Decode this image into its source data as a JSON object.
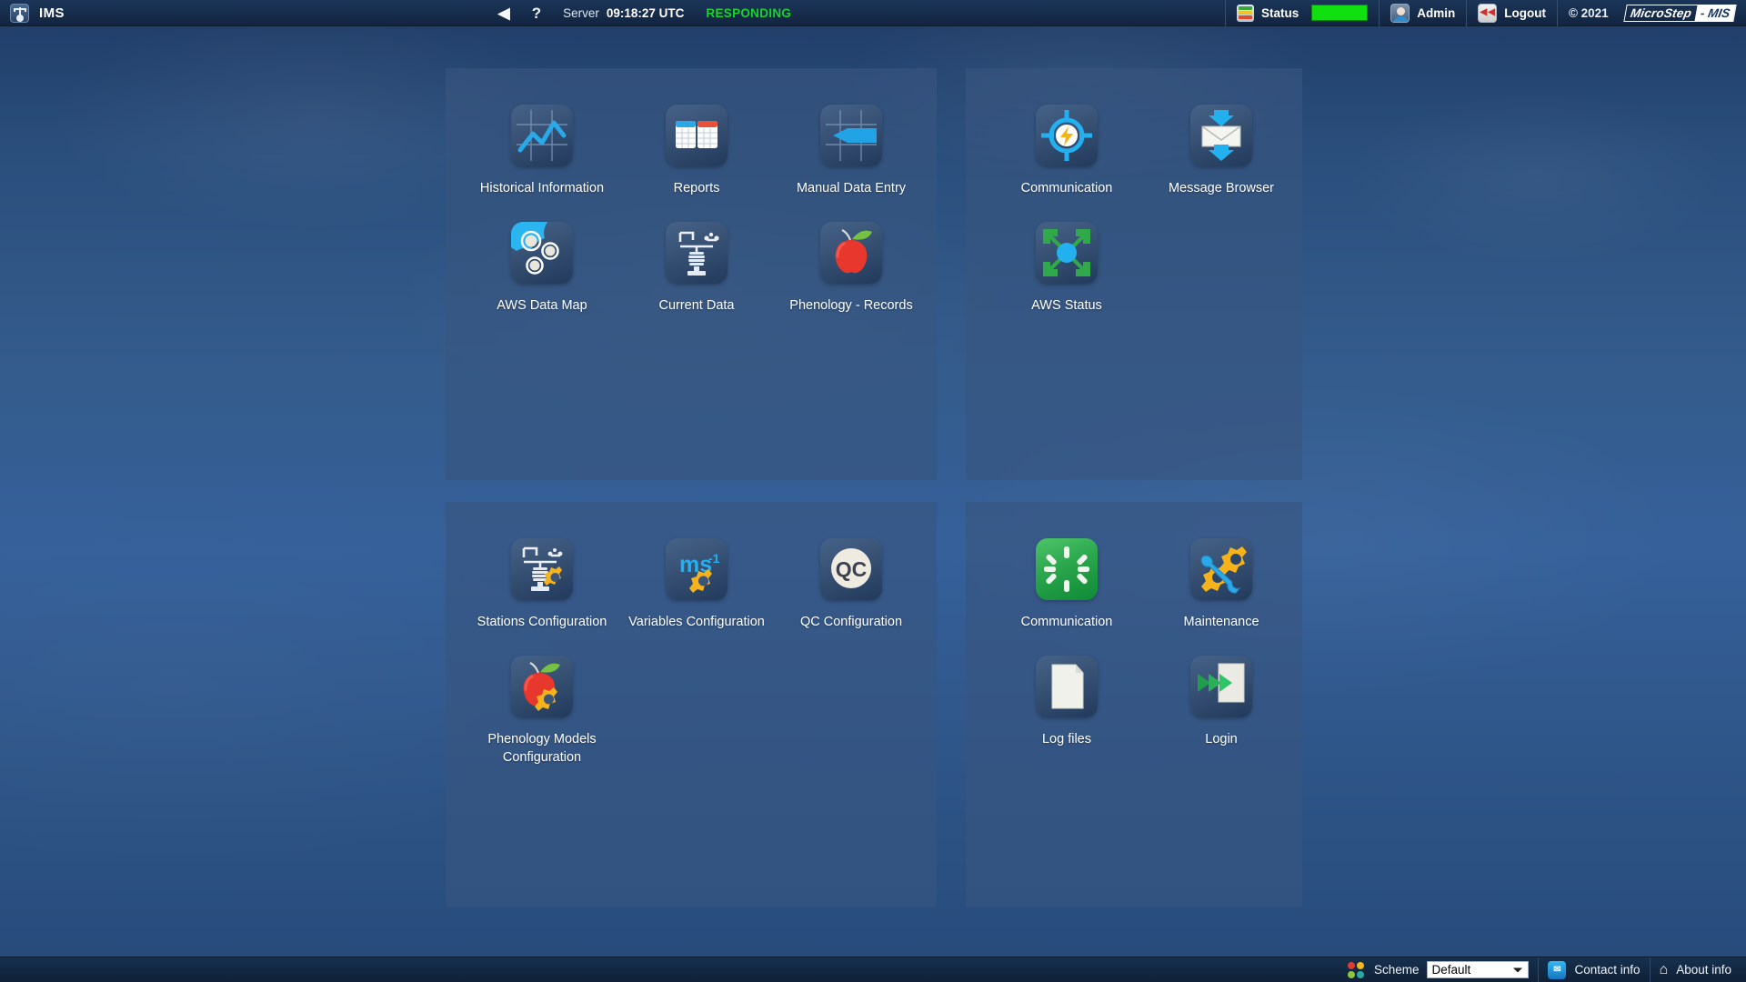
{
  "topbar": {
    "app_icon": "weather-station-icon",
    "app_title": "IMS",
    "back_icon": "◀",
    "help_icon": "?",
    "server_label": "Server",
    "server_time": "09:18:27 UTC",
    "server_state": "RESPONDING",
    "status_label": "Status",
    "status_led_color": "#10e010",
    "user_name": "Admin",
    "logout_label": "Logout",
    "copyright": "© 2021",
    "brand_part1": "MicroStep",
    "brand_part2": "- MIS"
  },
  "panels": [
    {
      "id": "panel-tl",
      "tiles": [
        {
          "label": "Historical Information",
          "icon": "line-chart-icon"
        },
        {
          "label": "Reports",
          "icon": "reports-tables-icon"
        },
        {
          "label": "Manual Data Entry",
          "icon": "manual-data-entry-icon"
        },
        {
          "label": "AWS Data Map",
          "icon": "aws-data-map-icon"
        },
        {
          "label": "Current Data",
          "icon": "weather-station-icon"
        },
        {
          "label": "Phenology - Records",
          "icon": "apple-icon"
        }
      ]
    },
    {
      "id": "panel-tr",
      "tiles": [
        {
          "label": "Communication",
          "icon": "communication-bolt-icon"
        },
        {
          "label": "Message Browser",
          "icon": "envelope-icon"
        },
        {
          "label": "AWS Status",
          "icon": "aws-status-arrows-icon"
        }
      ]
    },
    {
      "id": "panel-bl",
      "tiles": [
        {
          "label": "Stations Configuration",
          "icon": "station-gear-icon"
        },
        {
          "label": "Variables Configuration",
          "icon": "ms-gear-icon",
          "glyph": "ms"
        },
        {
          "label": "QC Configuration",
          "icon": "qc-circle-icon",
          "glyph": "QC"
        },
        {
          "label": "Phenology Models Configuration",
          "icon": "apple-gear-icon"
        }
      ]
    },
    {
      "id": "panel-br",
      "tiles": [
        {
          "label": "Communication",
          "icon": "green-sun-icon"
        },
        {
          "label": "Maintenance",
          "icon": "wrench-gear-icon"
        },
        {
          "label": "Log files",
          "icon": "document-icon"
        },
        {
          "label": "Login",
          "icon": "login-arrows-icon"
        }
      ]
    }
  ],
  "bottombar": {
    "scheme_label": "Scheme",
    "scheme_value": "Default",
    "scheme_options": [
      "Default"
    ],
    "contact_label": "Contact info",
    "about_label": "About info",
    "contact_icon": "contact-card-icon",
    "home_icon": "home-icon"
  }
}
